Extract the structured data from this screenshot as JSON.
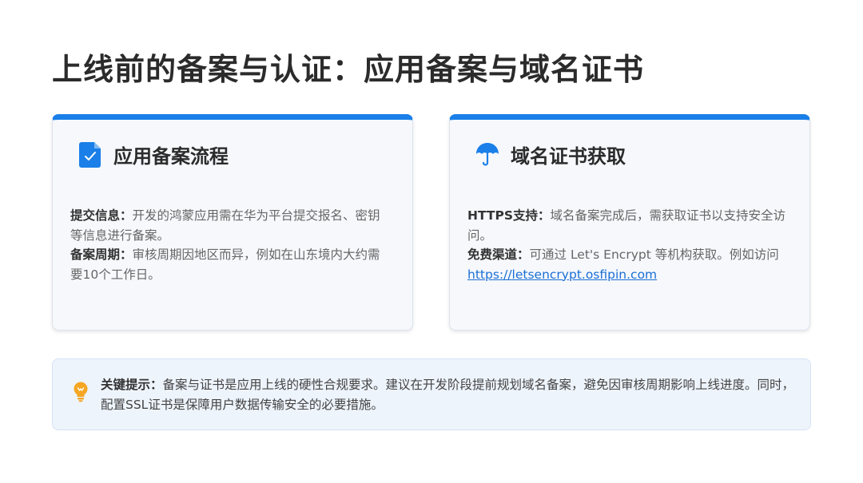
{
  "page": {
    "title": "上线前的备案与认证：应用备案与域名证书"
  },
  "cards": [
    {
      "icon": "document-check-icon",
      "title": "应用备案流程",
      "items": [
        {
          "label": "提交信息：",
          "text": "开发的鸿蒙应用需在华为平台提交报名、密钥等信息进行备案。"
        },
        {
          "label": "备案周期：",
          "text": "审核周期因地区而异，例如在山东境内大约需要10个工作日。"
        }
      ]
    },
    {
      "icon": "umbrella-icon",
      "title": "域名证书获取",
      "items": [
        {
          "label": "HTTPS支持：",
          "text": "域名备案完成后，需获取证书以支持安全访问。"
        },
        {
          "label": "免费渠道：",
          "text": "可通过 Let's Encrypt 等机构获取。例如访问",
          "link": "https://letsencrypt.osfipin.com"
        }
      ]
    }
  ],
  "tip": {
    "icon": "lightbulb-icon",
    "label": "关键提示：",
    "text": "备案与证书是应用上线的硬性合规要求。建议在开发阶段提前规划域名备案，避免因审核周期影响上线进度。同时，配置SSL证书是保障用户数据传输安全的必要措施。"
  },
  "colors": {
    "accent": "#1a7fe8",
    "tip_icon": "#f5a623",
    "card_bg": "#f6f8fc",
    "tip_bg": "#eef4fc"
  }
}
